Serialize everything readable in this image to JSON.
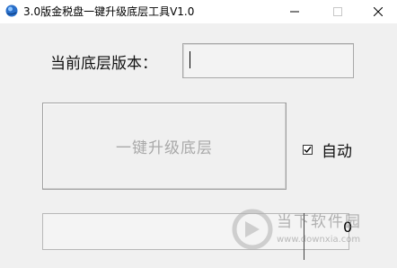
{
  "window": {
    "title": "3.0版金税盘一键升级底层工具V1.0",
    "icon": "app-globe-icon"
  },
  "form": {
    "version_label": "当前底层版本：",
    "version_value": ""
  },
  "upgrade_button": {
    "label": "一键升级底层"
  },
  "auto_option": {
    "label": "自动",
    "checked": true
  },
  "progress": {
    "count": "0"
  },
  "watermark": {
    "name": "当下软件园",
    "url": "www.downxia.com"
  },
  "colors": {
    "window_bg": "#f0f0f0",
    "disabled_text": "#a9a9a9"
  }
}
